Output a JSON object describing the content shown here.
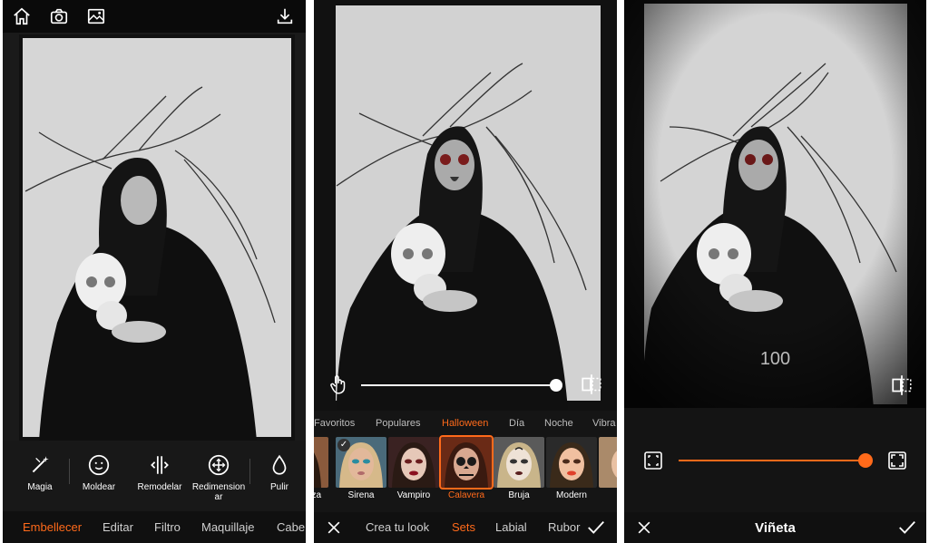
{
  "colors": {
    "accent": "#ff6a1a",
    "bar": "#181818"
  },
  "panel1": {
    "top_icons": [
      "home-icon",
      "camera-icon",
      "gallery-icon",
      "download-icon"
    ],
    "tools": [
      {
        "label": "Magia",
        "icon": "magic-wand-icon"
      },
      {
        "label": "Moldear",
        "icon": "face-icon"
      },
      {
        "label": "Remodelar",
        "icon": "reshape-icon"
      },
      {
        "label": "Redimension\nar",
        "icon": "resize-icon"
      },
      {
        "label": "Pulir",
        "icon": "drop-icon"
      }
    ],
    "tabs": [
      "Embellecer",
      "Editar",
      "Filtro",
      "Maquillaje",
      "Cabe"
    ]
  },
  "panel2": {
    "slider_value": 100,
    "categories": [
      "Favoritos",
      "Populares",
      "Halloween",
      "Día",
      "Noche",
      "Vibra"
    ],
    "active_category": "Halloween",
    "thumbs": [
      {
        "label": "aza"
      },
      {
        "label": "Sirena"
      },
      {
        "label": "Vampiro"
      },
      {
        "label": "Calavera"
      },
      {
        "label": "Bruja"
      },
      {
        "label": "Modern"
      },
      {
        "label": ""
      }
    ],
    "bottom_tabs": [
      "Crea tu look",
      "Sets",
      "Labial",
      "Rubor"
    ],
    "active_bottom_tab": "Sets"
  },
  "panel3": {
    "value": "100",
    "title": "Viñeta"
  }
}
